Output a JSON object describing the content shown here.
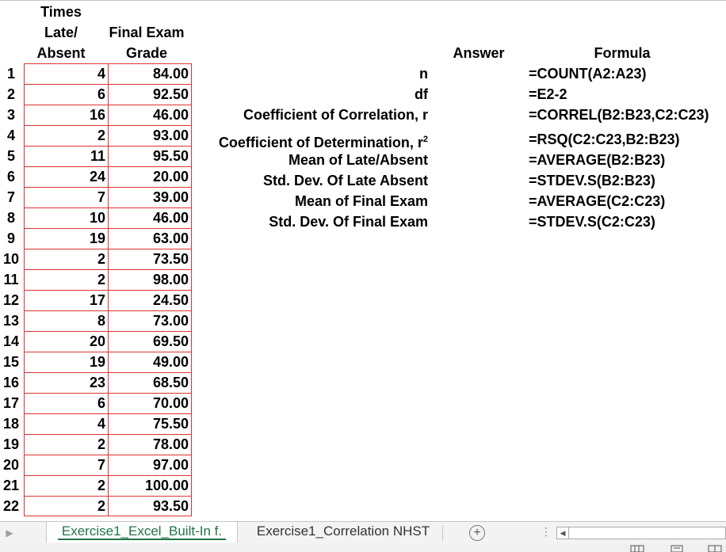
{
  "headers": {
    "col_b": [
      "Times",
      "Late/",
      "Absent"
    ],
    "col_c": [
      "Final Exam",
      "Grade"
    ],
    "answer": "Answer",
    "formula": "Formula"
  },
  "rows": [
    {
      "num": "1",
      "late": "4",
      "grade": "84.00"
    },
    {
      "num": "2",
      "late": "6",
      "grade": "92.50"
    },
    {
      "num": "3",
      "late": "16",
      "grade": "46.00"
    },
    {
      "num": "4",
      "late": "2",
      "grade": "93.00"
    },
    {
      "num": "5",
      "late": "11",
      "grade": "95.50"
    },
    {
      "num": "6",
      "late": "24",
      "grade": "20.00"
    },
    {
      "num": "7",
      "late": "7",
      "grade": "39.00"
    },
    {
      "num": "8",
      "late": "10",
      "grade": "46.00"
    },
    {
      "num": "9",
      "late": "19",
      "grade": "63.00"
    },
    {
      "num": "10",
      "late": "2",
      "grade": "73.50"
    },
    {
      "num": "11",
      "late": "2",
      "grade": "98.00"
    },
    {
      "num": "12",
      "late": "17",
      "grade": "24.50"
    },
    {
      "num": "13",
      "late": "8",
      "grade": "73.00"
    },
    {
      "num": "14",
      "late": "20",
      "grade": "69.50"
    },
    {
      "num": "15",
      "late": "19",
      "grade": "49.00"
    },
    {
      "num": "16",
      "late": "23",
      "grade": "68.50"
    },
    {
      "num": "17",
      "late": "6",
      "grade": "70.00"
    },
    {
      "num": "18",
      "late": "4",
      "grade": "75.50"
    },
    {
      "num": "19",
      "late": "2",
      "grade": "78.00"
    },
    {
      "num": "20",
      "late": "7",
      "grade": "97.00"
    },
    {
      "num": "21",
      "late": "2",
      "grade": "100.00"
    },
    {
      "num": "22",
      "late": "2",
      "grade": "93.50"
    }
  ],
  "stats": [
    {
      "label": "n",
      "formula": "=COUNT(A2:A23)"
    },
    {
      "label": "df",
      "formula": "=E2-2"
    },
    {
      "label": "Coefficient of Correlation, r",
      "formula": "=CORREL(B2:B23,C2:C23)"
    },
    {
      "label": "Coefficient of Determination, r",
      "sup": "2",
      "formula": "=RSQ(C2:C23,B2:B23)"
    },
    {
      "label": "Mean of Late/Absent",
      "formula": "=AVERAGE(B2:B23)"
    },
    {
      "label": "Std. Dev. Of Late Absent",
      "formula": "=STDEV.S(B2:B23)"
    },
    {
      "label": "Mean of Final Exam",
      "formula": "=AVERAGE(C2:C23)"
    },
    {
      "label": "Std. Dev. Of Final Exam",
      "formula": "=STDEV.S(C2:C23)"
    }
  ],
  "tabs": {
    "active": "Exercise1_Excel_Built-In f.",
    "inactive": "Exercise1_Correlation NHST",
    "add_symbol": "+"
  },
  "colors": {
    "cell_border": "#dd3333",
    "active_tab_text": "#217346"
  }
}
